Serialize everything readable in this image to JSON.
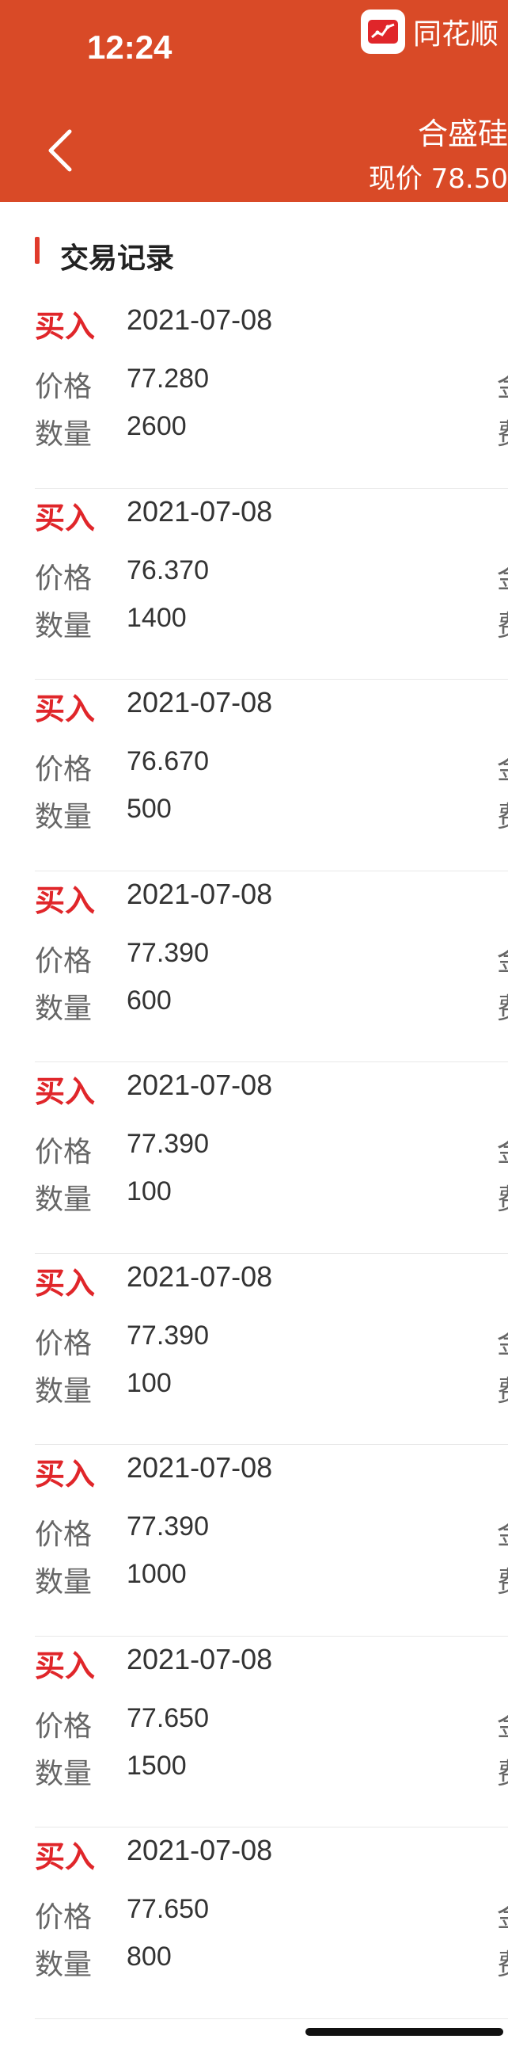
{
  "status_bar": {
    "time": "12:24"
  },
  "app": {
    "name": "同花顺"
  },
  "header": {
    "stock_name": "合盛硅",
    "price_text": "现价 78.50"
  },
  "section": {
    "title": "交易记录"
  },
  "labels": {
    "price": "价格",
    "qty": "数量",
    "edge_top": "金",
    "edge_bottom": "费"
  },
  "records": [
    {
      "type": "买入",
      "date": "2021-07-08",
      "price": "77.280",
      "qty": "2600"
    },
    {
      "type": "买入",
      "date": "2021-07-08",
      "price": "76.370",
      "qty": "1400"
    },
    {
      "type": "买入",
      "date": "2021-07-08",
      "price": "76.670",
      "qty": "500"
    },
    {
      "type": "买入",
      "date": "2021-07-08",
      "price": "77.390",
      "qty": "600"
    },
    {
      "type": "买入",
      "date": "2021-07-08",
      "price": "77.390",
      "qty": "100"
    },
    {
      "type": "买入",
      "date": "2021-07-08",
      "price": "77.390",
      "qty": "100"
    },
    {
      "type": "买入",
      "date": "2021-07-08",
      "price": "77.390",
      "qty": "1000"
    },
    {
      "type": "买入",
      "date": "2021-07-08",
      "price": "77.650",
      "qty": "1500"
    },
    {
      "type": "买入",
      "date": "2021-07-08",
      "price": "77.650",
      "qty": "800"
    }
  ],
  "colors": {
    "header_bg": "#d94a27",
    "buy_red": "#e0262a",
    "accent_bar": "#e03a2b"
  }
}
